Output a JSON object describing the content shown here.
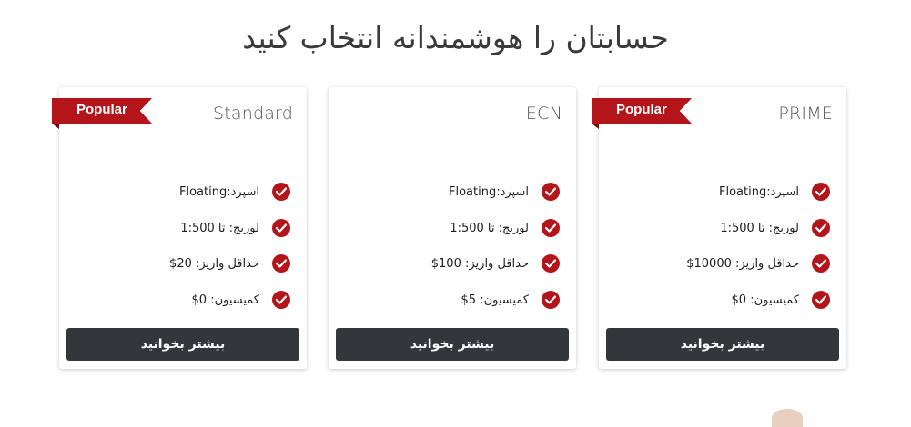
{
  "title": "حسابتان را هوشمندانه انتخاب کنید",
  "colors": {
    "accent": "#b3151b",
    "button_bg": "#33373b"
  },
  "cards": [
    {
      "name": "Standard",
      "ribbon": "Popular",
      "features": [
        "اسپرد:Floating",
        "لوریج: تا 1:500",
        "حداقل واریز: 20$",
        "کمیسیون: 0$"
      ],
      "button": "بیشتر بخوانید"
    },
    {
      "name": "ECN",
      "ribbon": "",
      "features": [
        "اسپرد:Floating",
        "لوریج: تا 1:500",
        "حداقل واریز: 100$",
        "کمیسیون: 5$"
      ],
      "button": "بیشتر بخوانید"
    },
    {
      "name": "PRIME",
      "ribbon": "Popular",
      "features": [
        "اسپرد:Floating",
        "لوریج: تا 1:500",
        "حداقل واریز: 10000$",
        "کمیسیون: 0$"
      ],
      "button": "بیشتر بخوانید"
    }
  ]
}
